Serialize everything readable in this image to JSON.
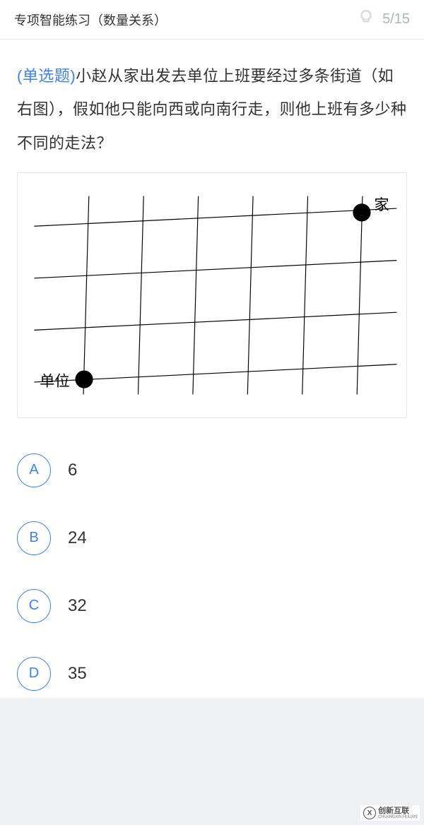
{
  "header": {
    "title": "专项智能练习（数量关系）",
    "progress": "5/15"
  },
  "question": {
    "type_label": "(单选题)",
    "text": "小赵从家出发去单位上班要经过多条街道（如右图），假如他只能向西或向南行走，则他上班有多少种不同的走法？"
  },
  "diagram": {
    "label_home": "家",
    "label_work": "单位"
  },
  "options": [
    {
      "letter": "A",
      "text": "6"
    },
    {
      "letter": "B",
      "text": "24"
    },
    {
      "letter": "C",
      "text": "32"
    },
    {
      "letter": "D",
      "text": "35"
    }
  ],
  "watermark": {
    "logo": "X",
    "cn": "创新互联",
    "en": "CHUANGXIN HULIAN"
  },
  "chart_data": {
    "type": "diagram",
    "description": "Street grid with 6 vertical lines and 4 horizontal lines (slightly slanted). Home (家) at top-right intersection, Work (单位) at bottom-left intersection. Problem: count paths moving only west or south.",
    "grid": {
      "vertical_lines": 6,
      "horizontal_lines": 4
    },
    "points": [
      {
        "label": "家",
        "position": "top-right"
      },
      {
        "label": "单位",
        "position": "bottom-left"
      }
    ]
  }
}
